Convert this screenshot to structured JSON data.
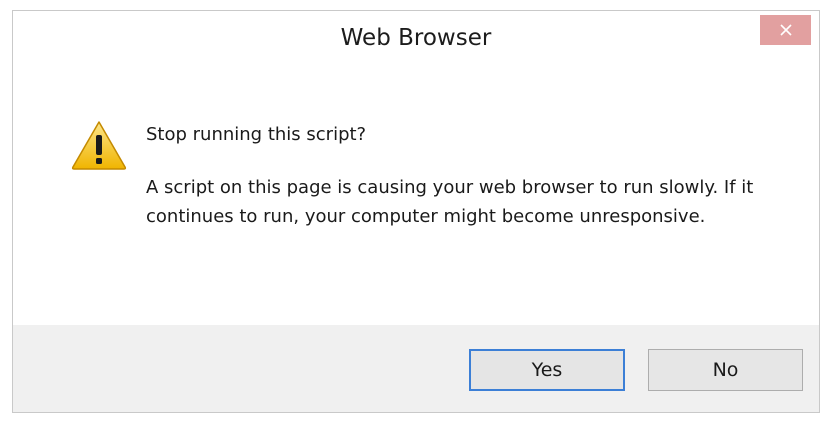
{
  "window": {
    "title": "Web Browser",
    "close_icon": "close-icon"
  },
  "dialog": {
    "icon": "warning-icon",
    "heading": "Stop running this script?",
    "message": "A script on this page is causing your web browser to run slowly. If it continues to run, your computer might become unresponsive."
  },
  "buttons": {
    "yes_label": "Yes",
    "no_label": "No"
  },
  "colors": {
    "close_button": "#e2a0a0",
    "default_button_border": "#3c7fd6",
    "footer_background": "#f0f0f0",
    "warning_fill": "#f5c518"
  }
}
